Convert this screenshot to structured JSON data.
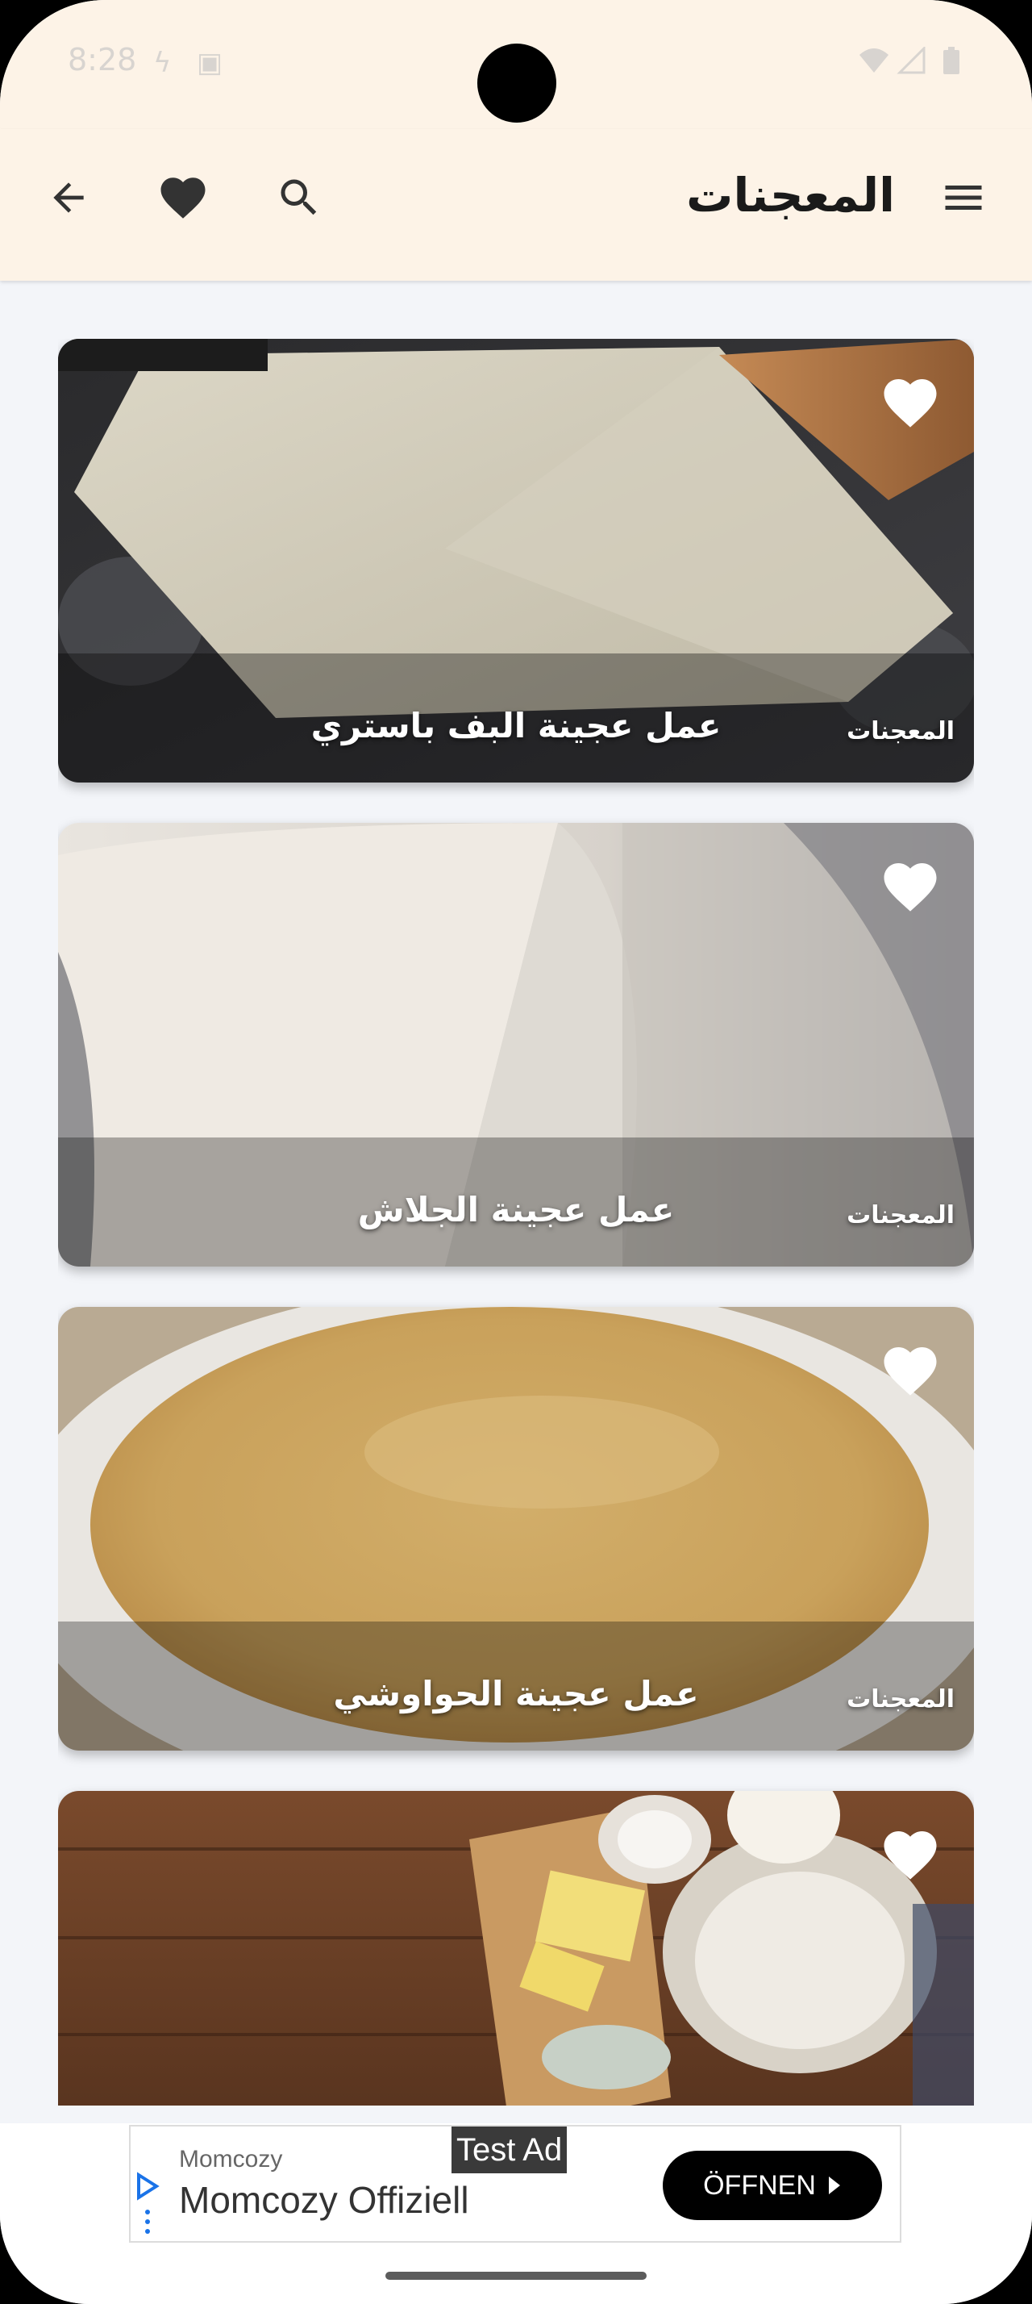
{
  "status": {
    "time": "8:28"
  },
  "appbar": {
    "title": "المعجنات",
    "icons": [
      "back-arrow-icon",
      "heart-icon",
      "search-icon",
      "menu-icon"
    ]
  },
  "cards": [
    {
      "title": "عمل عجينة البف باستري",
      "category": "المعجنات"
    },
    {
      "title": "عمل عجينة الجلاش",
      "category": "المعجنات"
    },
    {
      "title": "عمل عجينة الحواوشي",
      "category": "المعجنات"
    },
    {
      "title": "",
      "category": ""
    }
  ],
  "ad": {
    "tag": "Test Ad",
    "brand": "Momcozy",
    "title": "Momcozy Offiziell",
    "button": "ÖFFNEN"
  }
}
